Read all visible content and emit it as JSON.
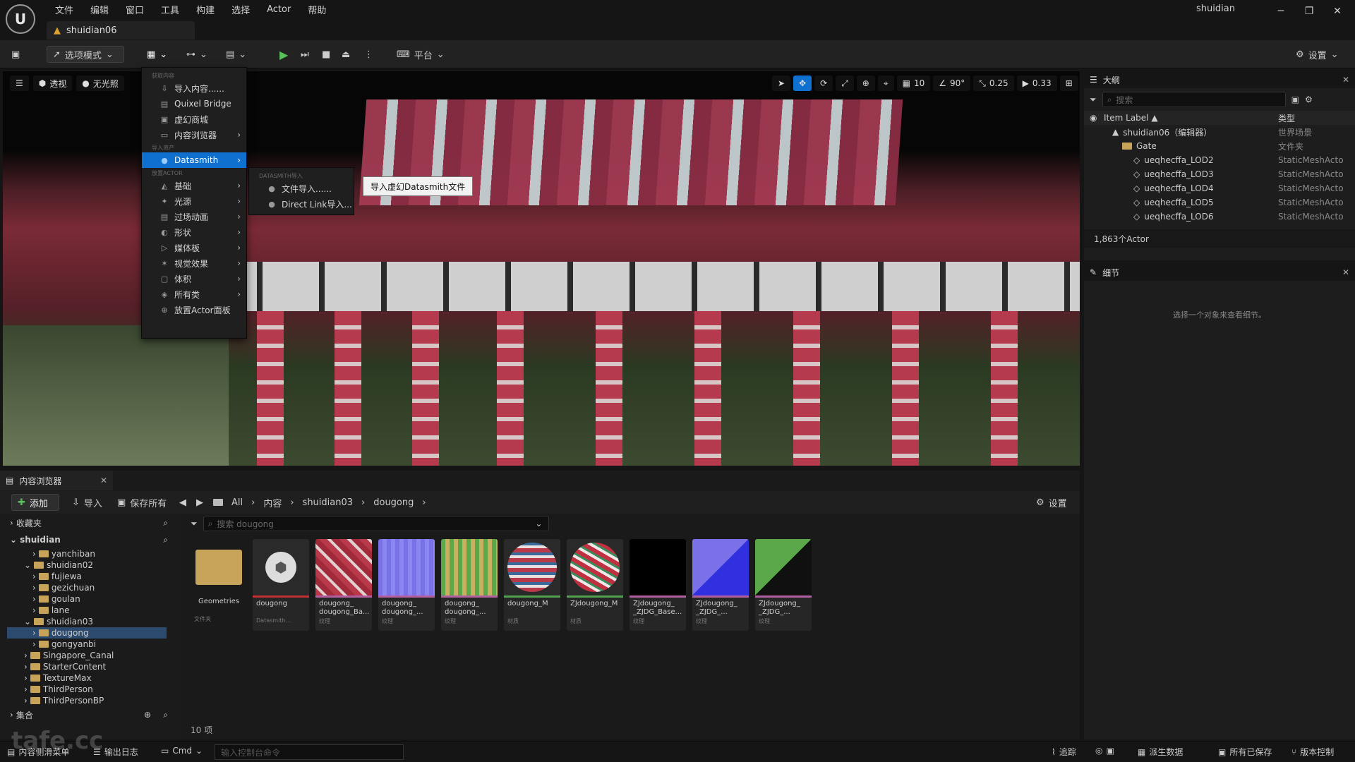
{
  "app": {
    "title": "shuidian06",
    "user": "shuidian"
  },
  "menubar": [
    "文件",
    "编辑",
    "窗口",
    "工具",
    "构建",
    "选择",
    "Actor",
    "帮助"
  ],
  "toolbar": {
    "mode": "选项模式",
    "platform": "平台",
    "settings": "设置"
  },
  "viewport": {
    "perspective": "透视",
    "lighting": "无光照",
    "grid": "10",
    "angle": "90°",
    "scale": "0.25",
    "camera": "0.33"
  },
  "add_menu": {
    "section1": "获取内容",
    "items1": [
      "导入内容......",
      "Quixel Bridge",
      "虚幻商城",
      "内容浏览器"
    ],
    "section2": "导入资产",
    "datasmith": "Datasmith",
    "section3": "放置ACTOR",
    "items3": [
      "基础",
      "光源",
      "过场动画",
      "形状",
      "媒体板",
      "视觉效果",
      "体积",
      "所有类",
      "放置Actor面板"
    ]
  },
  "submenu": {
    "section": "DATASMITH导入",
    "items": [
      "文件导入......",
      "Direct Link导入..."
    ]
  },
  "tooltip": "导入虚幻Datasmith文件",
  "outliner": {
    "tab": "大纲",
    "search_placeholder": "搜索",
    "col_label": "Item Label ▲",
    "col_type": "类型",
    "rows": [
      {
        "label": "shuidian06（编辑器）",
        "type": "世界场景"
      },
      {
        "label": "Gate",
        "type": "文件夹"
      },
      {
        "label": "ueqhecffa_LOD2",
        "type": "StaticMeshActo"
      },
      {
        "label": "ueqhecffa_LOD3",
        "type": "StaticMeshActo"
      },
      {
        "label": "ueqhecffa_LOD4",
        "type": "StaticMeshActo"
      },
      {
        "label": "ueqhecffa_LOD5",
        "type": "StaticMeshActo"
      },
      {
        "label": "ueqhecffa_LOD6",
        "type": "StaticMeshActo"
      }
    ],
    "count": "1,863个Actor"
  },
  "details": {
    "tab": "细节",
    "empty": "选择一个对象来查看细节。"
  },
  "content_browser": {
    "tab": "内容浏览器",
    "add": "添加",
    "import": "导入",
    "save_all": "保存所有",
    "breadcrumb": [
      "All",
      "内容",
      "shuidian03",
      "dougong"
    ],
    "settings": "设置",
    "favorites": "收藏夹",
    "root": "shuidian",
    "search_placeholder": "搜索 dougong",
    "tree": [
      "yanchiban",
      "shuidian02",
      "fujiewa",
      "gezichuan",
      "goulan",
      "lane",
      "shuidian03",
      "dougong",
      "gongyanbi",
      "Singapore_Canal",
      "StarterContent",
      "TextureMax",
      "ThirdPerson",
      "ThirdPersonBP"
    ],
    "collections": "集合",
    "count": "10 项",
    "tiles": [
      {
        "name": "Geometries",
        "type": "文件夹"
      },
      {
        "name": "dougong",
        "type": "Datasmith..."
      },
      {
        "name": "dougong_ dougong_Ba...",
        "type": "纹理"
      },
      {
        "name": "dougong_ dougong_...",
        "type": "纹理"
      },
      {
        "name": "dougong_ dougong_...",
        "type": "纹理"
      },
      {
        "name": "dougong_M",
        "type": "材质"
      },
      {
        "name": "ZJdougong_M",
        "type": "材质"
      },
      {
        "name": "ZJdougong_ _ZJDG_Base...",
        "type": "纹理"
      },
      {
        "name": "ZJdougong_ _ZJDG_...",
        "type": "纹理"
      },
      {
        "name": "ZJdougong_ _ZJDG_...",
        "type": "纹理"
      }
    ]
  },
  "statusbar": {
    "drawer": "内容侧滑菜单",
    "log": "输出日志",
    "cmd": "Cmd",
    "cmd_placeholder": "输入控制台命令",
    "trace": "追踪",
    "derived": "派生数据",
    "saved": "所有已保存",
    "version": "版本控制"
  },
  "watermark": "tafe.cc"
}
